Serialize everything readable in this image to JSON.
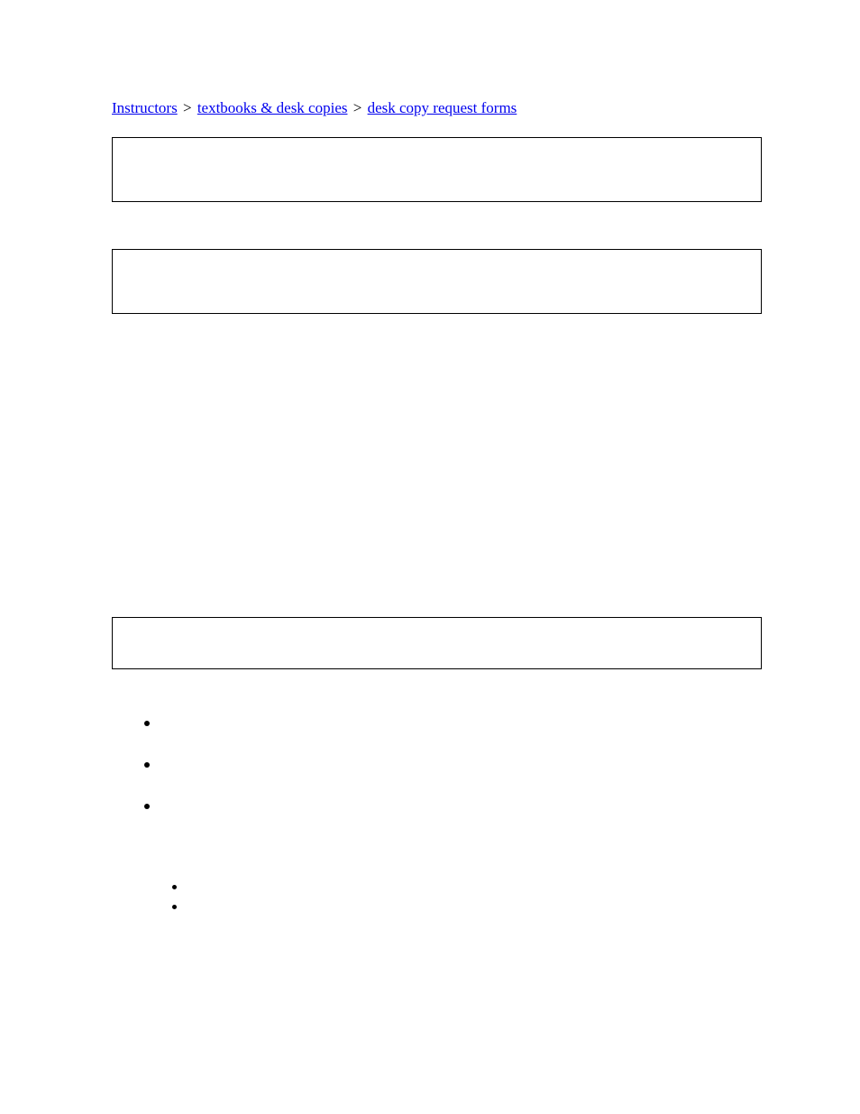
{
  "breadcrumb": {
    "items": [
      {
        "label": "Instructors"
      },
      {
        "label": "textbooks & desk copies"
      },
      {
        "label": "desk copy request forms"
      }
    ],
    "separator": " > "
  }
}
